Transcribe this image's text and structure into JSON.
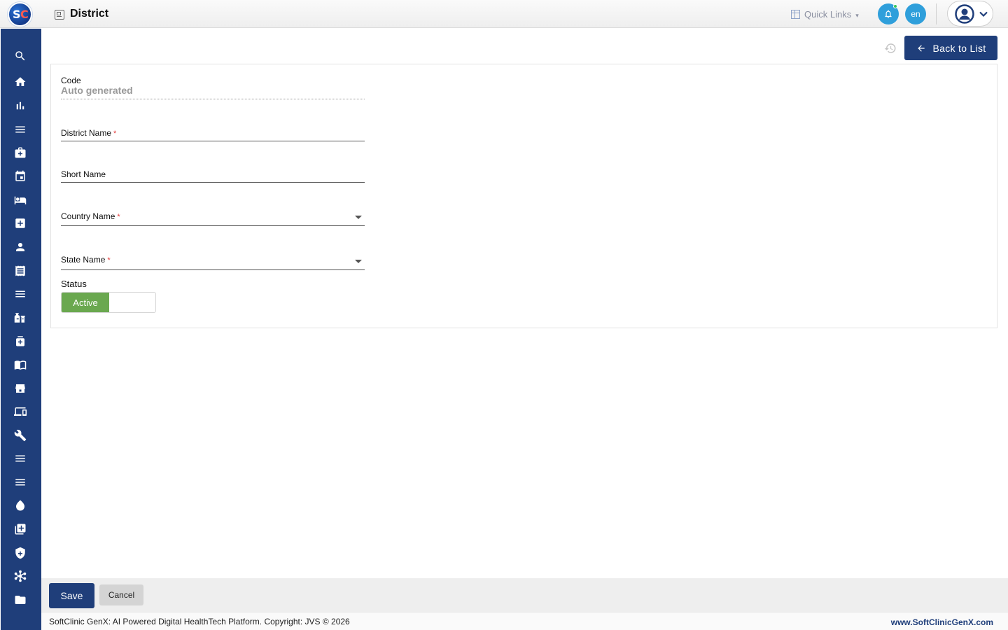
{
  "app": {
    "logo_letters": [
      "S",
      "C"
    ],
    "page_title": "District"
  },
  "header": {
    "quick_links_label": "Quick Links",
    "language_code": "en",
    "notification_has_new": true
  },
  "toolbar": {
    "back_label": "Back to List",
    "history_icon": "history-icon"
  },
  "form": {
    "code": {
      "label": "Code",
      "value": "Auto generated"
    },
    "district_name": {
      "label": "District Name",
      "required_mark": "*",
      "value": ""
    },
    "short_name": {
      "label": "Short Name",
      "value": ""
    },
    "country_name": {
      "label": "Country Name",
      "required_mark": "*",
      "value": ""
    },
    "state_name": {
      "label": "State Name",
      "required_mark": "*",
      "value": ""
    },
    "status": {
      "label": "Status",
      "value": "Active"
    }
  },
  "actions": {
    "save_label": "Save",
    "cancel_label": "Cancel"
  },
  "footer": {
    "copyright": "SoftClinic GenX: AI Powered Digital HealthTech Platform. Copyright: JVS © 2026",
    "website": "www.SoftClinicGenX.com"
  },
  "sidebar": {
    "icons": [
      "search-icon",
      "home-icon",
      "bar-chart-icon",
      "menu-icon",
      "medical-bag-icon",
      "calendar-icon",
      "bed-icon",
      "first-aid-icon",
      "person-icon",
      "receipt-icon",
      "menu-icon",
      "lab-bottles-icon",
      "medicine-bottle-icon",
      "book-icon",
      "store-icon",
      "devices-icon",
      "wrench-icon",
      "menu-icon",
      "menu-icon",
      "drop-icon",
      "add-box-icon",
      "shield-icon",
      "hub-icon",
      "folder-icon"
    ]
  },
  "colors": {
    "primary": "#1f3e7a",
    "accent_blue": "#2f9fdb",
    "active_green": "#6aa84f",
    "required_red": "#e23b3b",
    "logo_red": "#ff5a4e"
  }
}
